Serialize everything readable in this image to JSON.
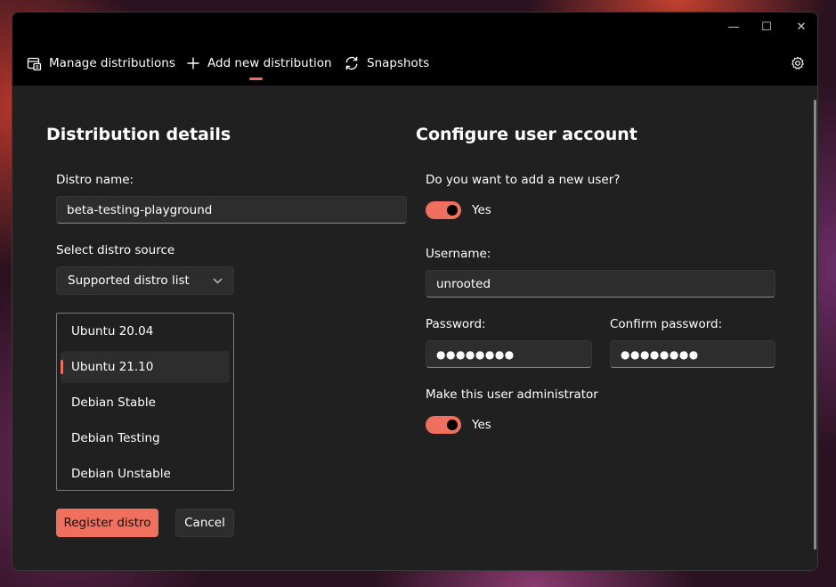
{
  "window": {
    "controls": {
      "minimize_icon": "—",
      "maximize_icon": "☐",
      "close_icon": "✕"
    }
  },
  "nav": {
    "items": [
      {
        "label": "Manage distributions",
        "icon": "manage-distributions-icon"
      },
      {
        "label": "Add new distribution",
        "icon": "plus-icon",
        "active": true
      },
      {
        "label": "Snapshots",
        "icon": "refresh-icon"
      }
    ],
    "settings_icon": "gear-icon"
  },
  "distribution": {
    "title": "Distribution details",
    "name_label": "Distro name:",
    "name_value": "beta-testing-playground",
    "source_label": "Select distro source",
    "source_selected": "Supported distro list",
    "distros": [
      {
        "label": "Ubuntu 20.04",
        "selected": false
      },
      {
        "label": "Ubuntu 21.10",
        "selected": true
      },
      {
        "label": "Debian Stable",
        "selected": false
      },
      {
        "label": "Debian Testing",
        "selected": false
      },
      {
        "label": "Debian Unstable",
        "selected": false
      }
    ],
    "register_label": "Register distro",
    "cancel_label": "Cancel"
  },
  "user": {
    "title": "Configure user account",
    "add_user_question": "Do you want to add a new user?",
    "add_user_toggle_label": "Yes",
    "add_user_on": true,
    "username_label": "Username:",
    "username_value": "unrooted",
    "password_label": "Password:",
    "password_value": "●●●●●●●●",
    "confirm_label": "Confirm password:",
    "confirm_value": "●●●●●●●●",
    "admin_label": "Make this user administrator",
    "admin_toggle_label": "Yes",
    "admin_on": true
  },
  "colors": {
    "accent": "#f07060",
    "window_bg": "#202020",
    "titlebar_bg": "#000000",
    "control_bg": "#2d2d2d"
  }
}
